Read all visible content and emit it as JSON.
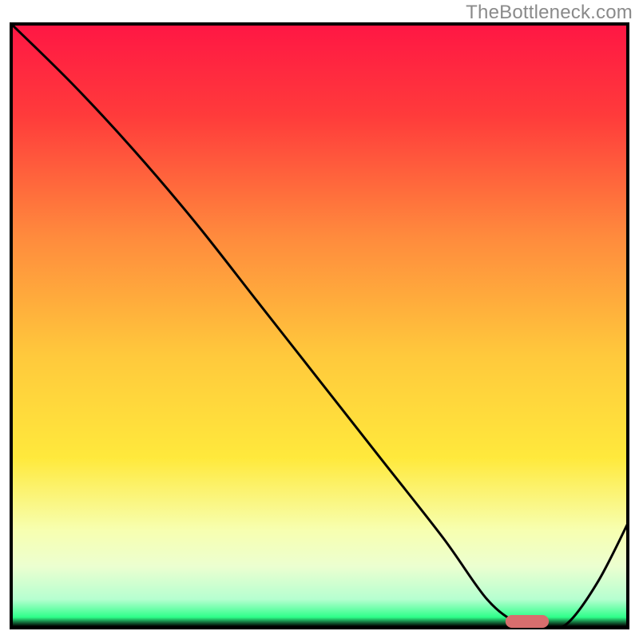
{
  "watermark": "TheBottleneck.com",
  "chart_data": {
    "type": "line",
    "title": "",
    "xlabel": "",
    "ylabel": "",
    "xlim": [
      0,
      100
    ],
    "ylim": [
      0,
      100
    ],
    "grid": false,
    "legend": false,
    "series": [
      {
        "name": "curve",
        "x": [
          0,
          10,
          20,
          30,
          40,
          50,
          60,
          70,
          77,
          82,
          86,
          90,
          95,
          100
        ],
        "y": [
          100,
          90,
          79,
          67,
          54,
          41,
          28,
          15,
          5,
          1,
          0,
          1,
          8,
          18
        ]
      }
    ],
    "marker": {
      "name": "optimal-range",
      "x_start": 80,
      "x_end": 87,
      "y": 0
    },
    "gradient_stops": [
      {
        "offset": 0.0,
        "color": "#ff1744"
      },
      {
        "offset": 0.15,
        "color": "#ff3b3b"
      },
      {
        "offset": 0.35,
        "color": "#ff8a3d"
      },
      {
        "offset": 0.55,
        "color": "#ffc93c"
      },
      {
        "offset": 0.72,
        "color": "#ffe93c"
      },
      {
        "offset": 0.84,
        "color": "#f7ffb0"
      },
      {
        "offset": 0.9,
        "color": "#ecffd0"
      },
      {
        "offset": 0.955,
        "color": "#b6ffd0"
      },
      {
        "offset": 0.985,
        "color": "#2eff8a"
      },
      {
        "offset": 1.0,
        "color": "#000000"
      }
    ],
    "marker_color": "#d86e6e"
  }
}
